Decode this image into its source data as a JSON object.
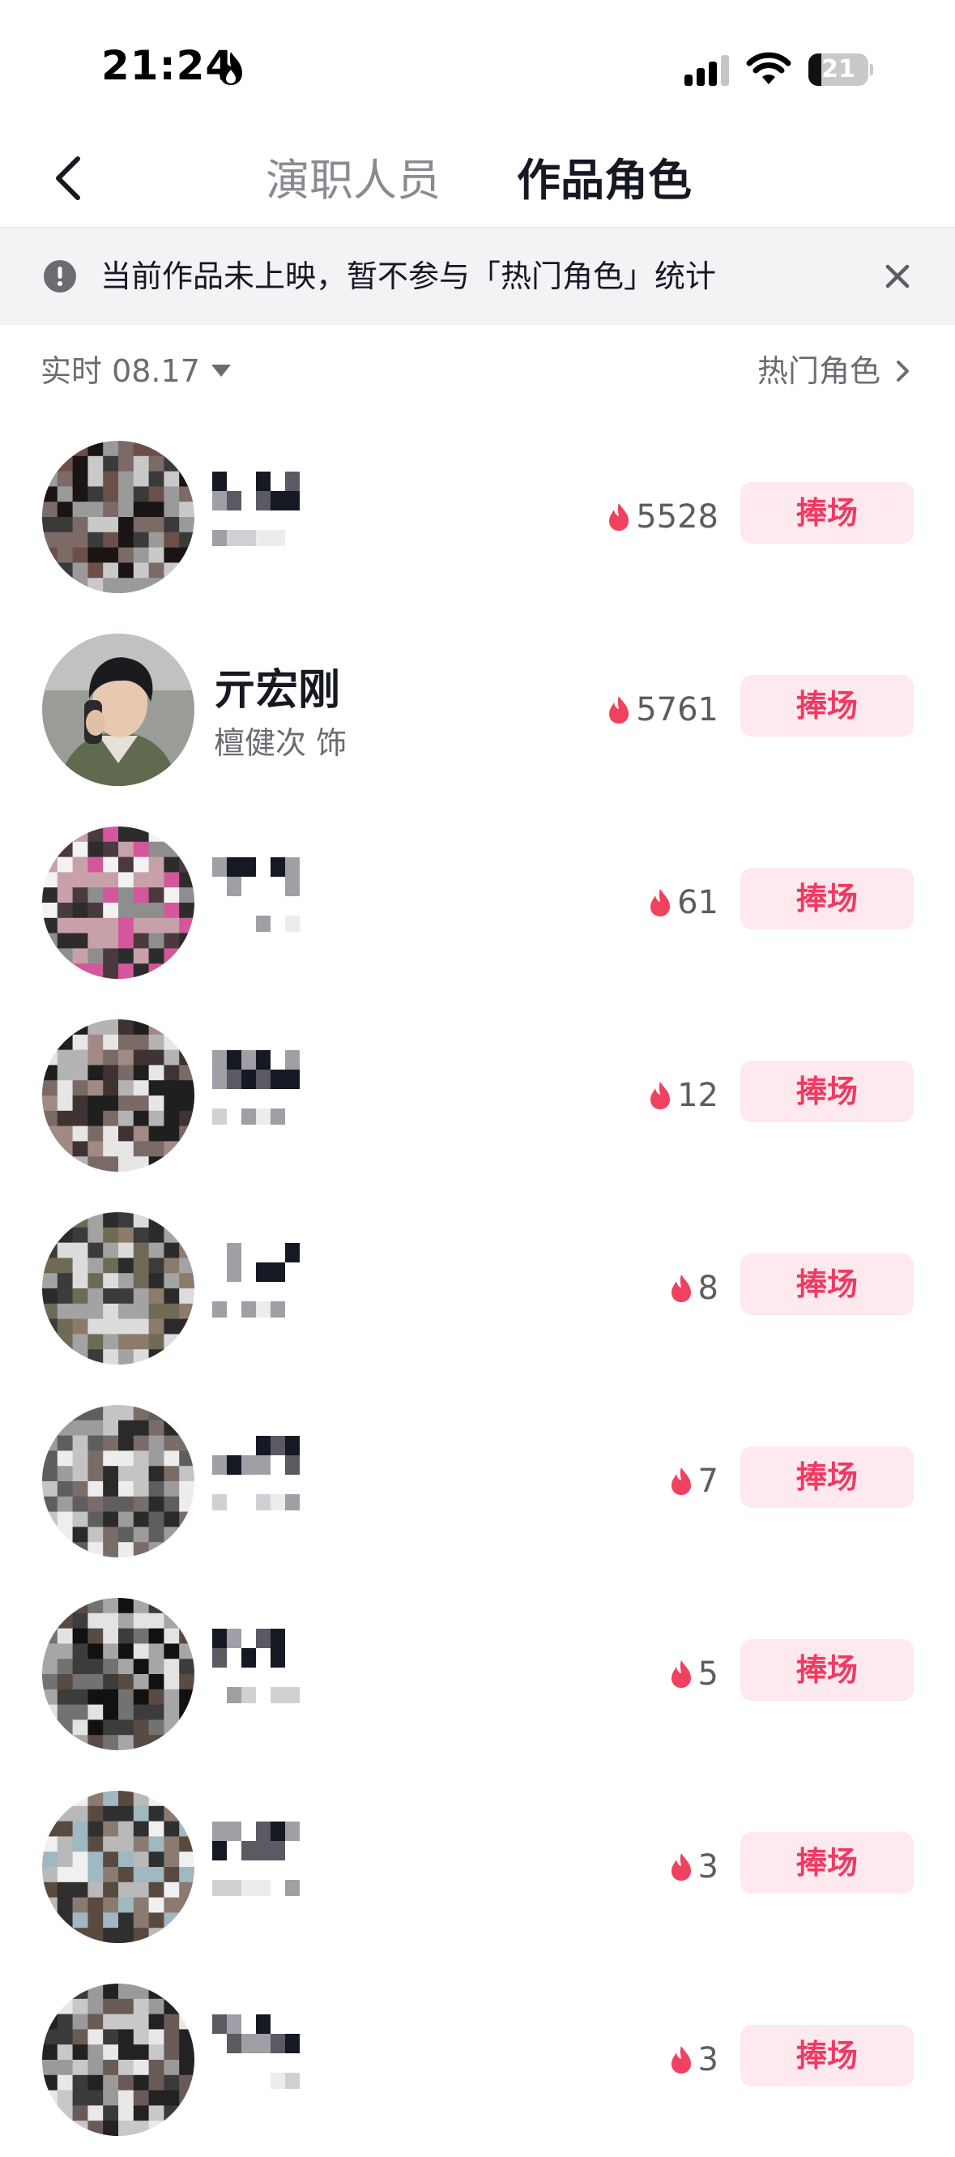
{
  "status_bar": {
    "time": "21:24",
    "battery_level": "21",
    "battery_fraction": 0.21
  },
  "nav": {
    "tabs": [
      {
        "label": "演职人员",
        "active": false
      },
      {
        "label": "作品角色",
        "active": true
      }
    ]
  },
  "notice": {
    "text": "当前作品未上映，暂不参与「热门角色」统计"
  },
  "filter": {
    "time_label": "实时 08.17",
    "hot_roles_link": "热门角色"
  },
  "roles": [
    {
      "name": "",
      "actor": "",
      "heat": "5528",
      "button": "捧场",
      "pixelated": true
    },
    {
      "name": "亓宏刚",
      "actor": "檀健次 饰",
      "heat": "5761",
      "button": "捧场",
      "pixelated": false
    },
    {
      "name": "",
      "actor": "",
      "heat": "61",
      "button": "捧场",
      "pixelated": true
    },
    {
      "name": "",
      "actor": "",
      "heat": "12",
      "button": "捧场",
      "pixelated": true
    },
    {
      "name": "",
      "actor": "",
      "heat": "8",
      "button": "捧场",
      "pixelated": true
    },
    {
      "name": "",
      "actor": "",
      "heat": "7",
      "button": "捧场",
      "pixelated": true
    },
    {
      "name": "",
      "actor": "",
      "heat": "5",
      "button": "捧场",
      "pixelated": true
    },
    {
      "name": "",
      "actor": "",
      "heat": "3",
      "button": "捧场",
      "pixelated": true
    },
    {
      "name": "",
      "actor": "",
      "heat": "3",
      "button": "捧场",
      "pixelated": true
    }
  ],
  "colors": {
    "accent": "#ef3a63",
    "button_bg": "#fde9ee",
    "notice_bg": "#f3f3f5",
    "flame": "#f0425f"
  },
  "icons": {
    "back": "chevron-left-icon",
    "notice": "exclamation-circle-icon",
    "close": "close-icon",
    "caret": "caret-down-icon",
    "arrow": "chevron-right-icon",
    "heat": "flame-icon"
  }
}
